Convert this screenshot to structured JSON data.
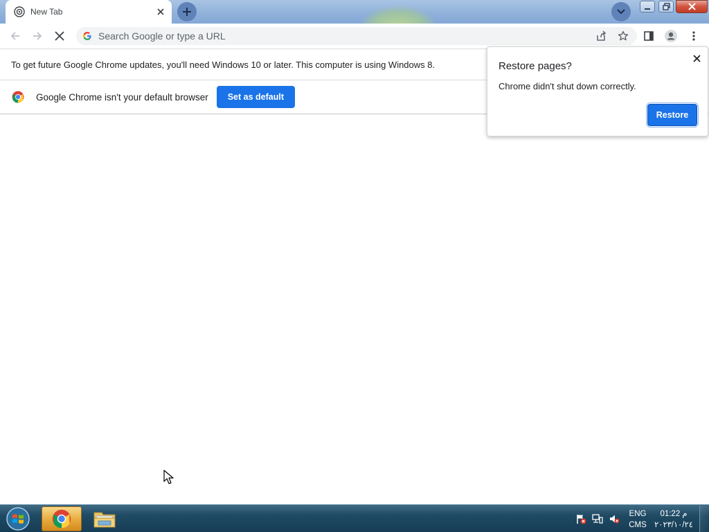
{
  "tab": {
    "title": "New Tab"
  },
  "toolbar": {
    "omnibox_placeholder": "Search Google or type a URL"
  },
  "infobar_update": {
    "text": "To get future Google Chrome updates, you'll need Windows 10 or later. This computer is using Windows 8."
  },
  "infobar_default": {
    "text": "Google Chrome isn't your default browser",
    "button_label": "Set as default"
  },
  "restore_bubble": {
    "title": "Restore pages?",
    "message": "Chrome didn't shut down correctly.",
    "button_label": "Restore"
  },
  "taskbar": {
    "language": "ENG",
    "ime": "CMS",
    "time": "01:22 م",
    "date": "٢٠٢٣/١٠/٢٤"
  },
  "colors": {
    "accent": "#1a73e8",
    "tab_strip": "#8fb0da",
    "taskbar": "#1f4a63"
  }
}
